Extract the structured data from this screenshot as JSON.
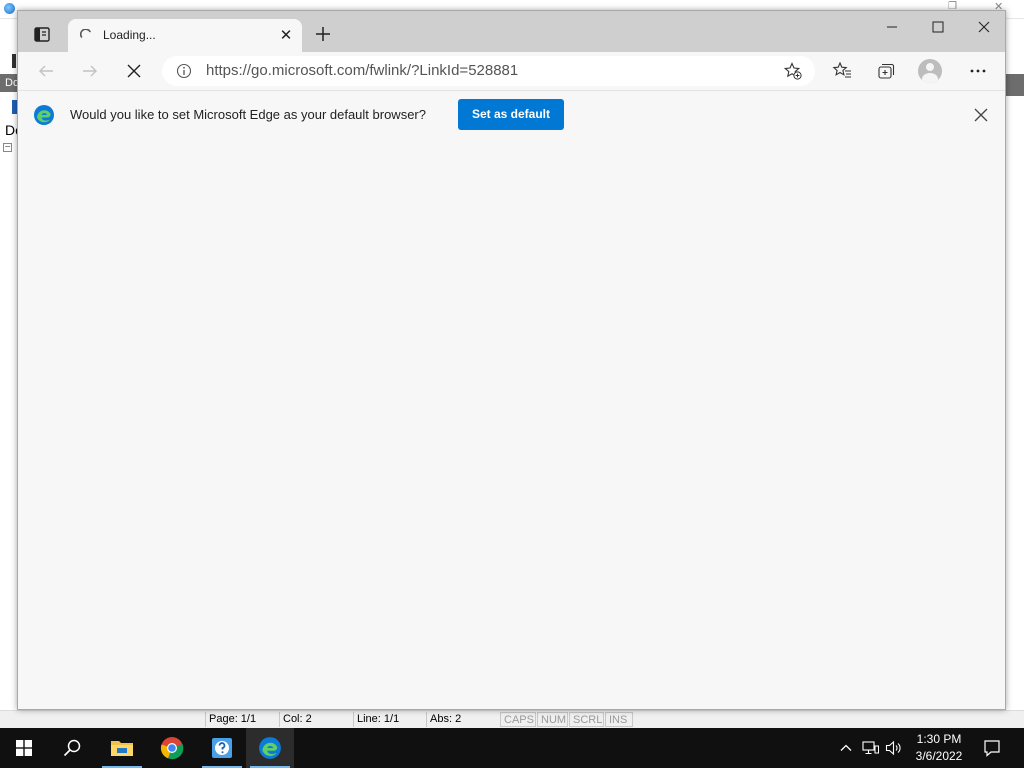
{
  "background_app": {
    "menu_fragment": "Do",
    "doc_fragment": "Do",
    "status": {
      "page": "Page: 1/1",
      "col": "Col: 2",
      "line": "Line: 1/1",
      "abs": "Abs: 2",
      "caps": "CAPS",
      "num": "NUM",
      "scrl": "SCRL",
      "ins": "INS"
    }
  },
  "browser": {
    "tab": {
      "title": "Loading...",
      "state": "loading"
    },
    "address": {
      "url": "https://go.microsoft.com/fwlink/?LinkId=528881"
    },
    "infobar": {
      "message": "Would you like to set Microsoft Edge as your default browser?",
      "button_label": "Set as default"
    },
    "colors": {
      "accent": "#0078d4",
      "tabstrip": "#cfcfcf",
      "page_background": "#f7f7f7"
    }
  },
  "taskbar": {
    "apps": [
      "start-icon",
      "search-icon",
      "file-explorer-icon",
      "chrome-icon",
      "help-app-icon",
      "edge-icon"
    ],
    "clock": {
      "time": "1:30 PM",
      "date": "3/6/2022"
    }
  }
}
